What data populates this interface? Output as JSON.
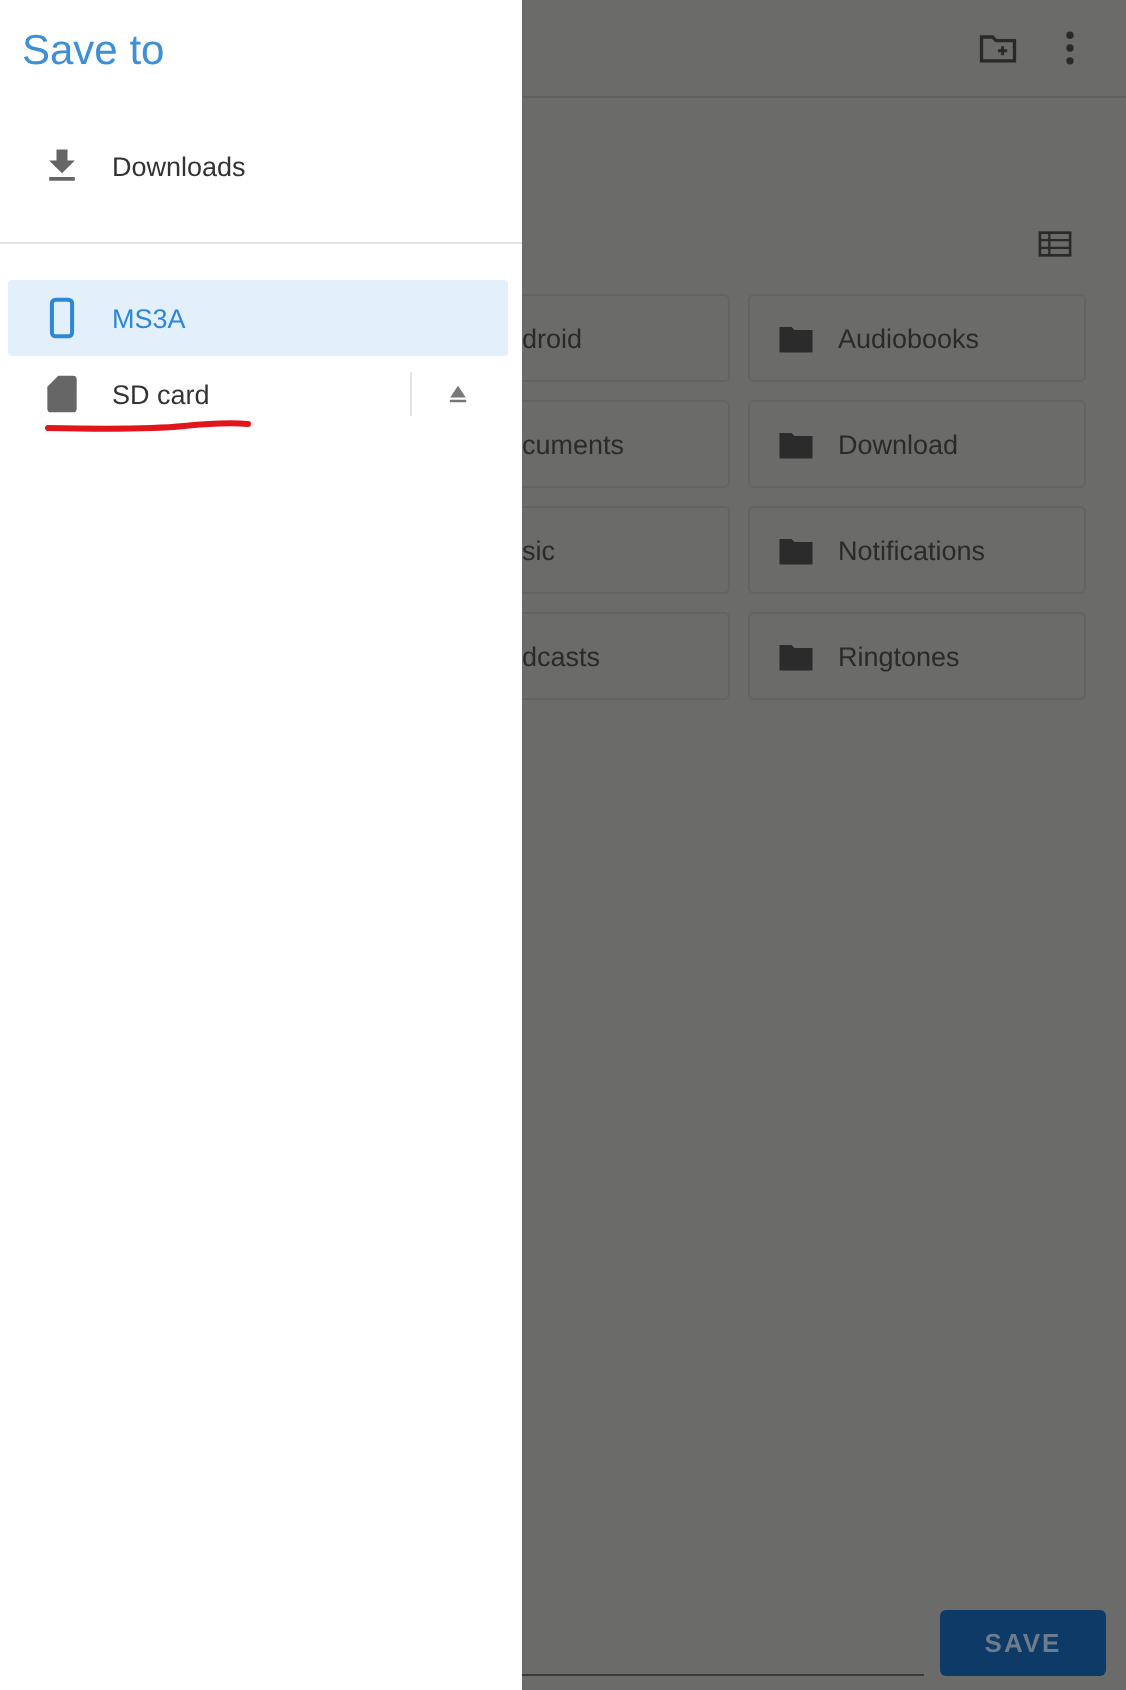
{
  "drawer": {
    "title": "Save to",
    "shortcuts": [
      {
        "label": "Downloads",
        "selected": false
      }
    ],
    "roots": [
      {
        "label": "MS3A",
        "kind": "device",
        "selected": true,
        "ejectable": false,
        "underlined": false
      },
      {
        "label": "SD card",
        "kind": "sdcard",
        "selected": false,
        "ejectable": true,
        "underlined": true
      }
    ]
  },
  "folders": [
    {
      "label": "droid"
    },
    {
      "label": "Audiobooks"
    },
    {
      "label": "cuments"
    },
    {
      "label": "Download"
    },
    {
      "label": "sic"
    },
    {
      "label": "Notifications"
    },
    {
      "label": "dcasts"
    },
    {
      "label": "Ringtones"
    }
  ],
  "save_button": "SAVE"
}
